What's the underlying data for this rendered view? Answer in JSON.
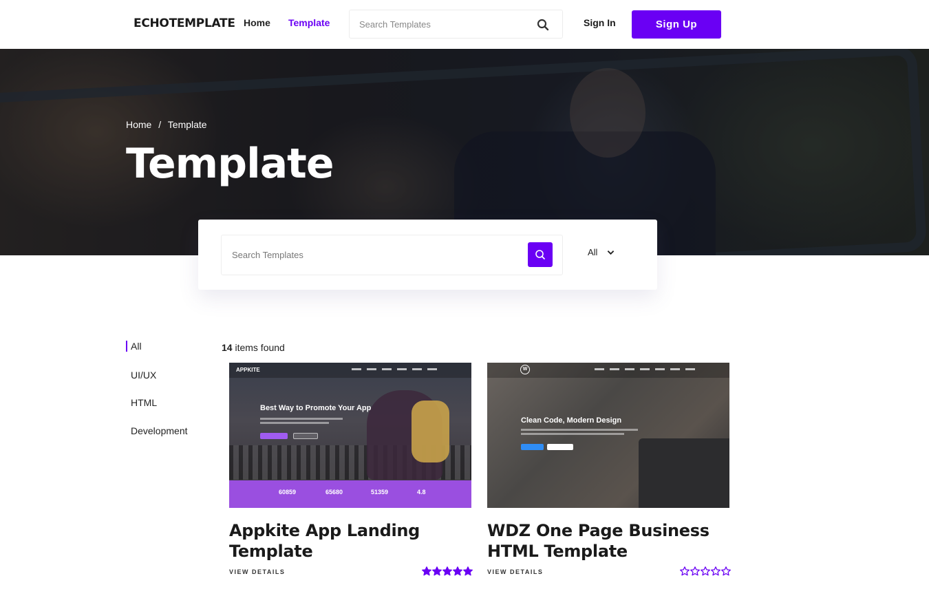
{
  "header": {
    "logo": "ECHOTEMPLATE",
    "nav": [
      {
        "label": "Home"
      },
      {
        "label": "Template"
      }
    ],
    "search_placeholder": "Search Templates",
    "signin_label": "Sign In",
    "signup_label": "Sign Up"
  },
  "hero": {
    "breadcrumb": [
      "Home",
      "Template"
    ],
    "breadcrumb_sep": "/",
    "title": "Template"
  },
  "search_panel": {
    "placeholder": "Search Templates",
    "filter_value": "All"
  },
  "categories": [
    {
      "label": "All",
      "active": true
    },
    {
      "label": "UI/UX",
      "active": false
    },
    {
      "label": "HTML",
      "active": false
    },
    {
      "label": "Development",
      "active": false
    }
  ],
  "results": {
    "count": "14",
    "count_suffix": " items found"
  },
  "cards": [
    {
      "title": "Appkite App Landing Template",
      "view_label": "VIEW DETAILS",
      "rating": 5,
      "thumb": {
        "brand": "APPKITE",
        "headline": "Best Way to Promote Your App",
        "stats": [
          "60859",
          "65680",
          "51359",
          "4.8"
        ]
      }
    },
    {
      "title": "WDZ One Page Business HTML Template",
      "view_label": "VIEW DETAILS",
      "rating": 0,
      "thumb": {
        "logo": "W",
        "headline": "Clean Code, Modern Design"
      }
    }
  ],
  "colors": {
    "accent": "#6a00f4",
    "text": "#1a1a1a",
    "stats_bar": "#9a4fe0"
  },
  "icons": {
    "search": "search-icon",
    "chevron": "chevron-down-icon",
    "star": "star-icon"
  }
}
